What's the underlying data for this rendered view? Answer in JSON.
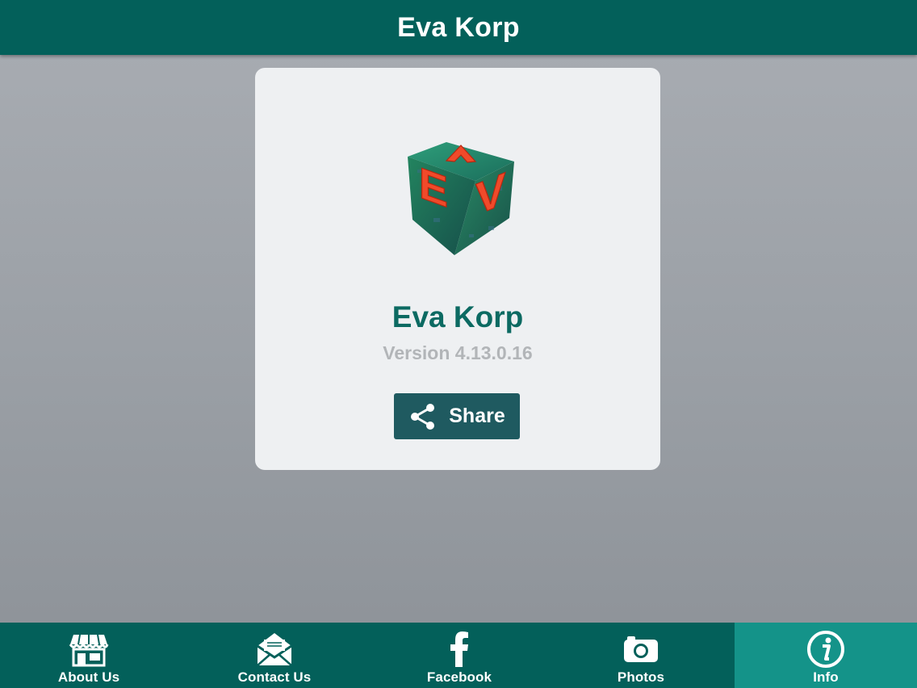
{
  "header": {
    "title": "Eva Korp"
  },
  "card": {
    "logo_icon": "ev-cube-logo",
    "logo_letters": [
      "E",
      "V",
      "A"
    ],
    "app_name": "Eva Korp",
    "version": "Version 4.13.0.16",
    "share_label": "Share",
    "share_icon": "share-icon"
  },
  "tabs": [
    {
      "label": "About Us",
      "icon": "storefront-icon",
      "active": false
    },
    {
      "label": "Contact Us",
      "icon": "envelope-icon",
      "active": false
    },
    {
      "label": "Facebook",
      "icon": "facebook-icon",
      "active": false
    },
    {
      "label": "Photos",
      "icon": "camera-icon",
      "active": false
    },
    {
      "label": "Info",
      "icon": "info-icon",
      "active": true
    }
  ],
  "colors": {
    "primary": "#03605a",
    "active_tab": "#149389",
    "app_name": "#0c6a62",
    "version": "#b2b5b8",
    "share_button": "#1f5a60",
    "card_bg": "#eef0f2"
  }
}
